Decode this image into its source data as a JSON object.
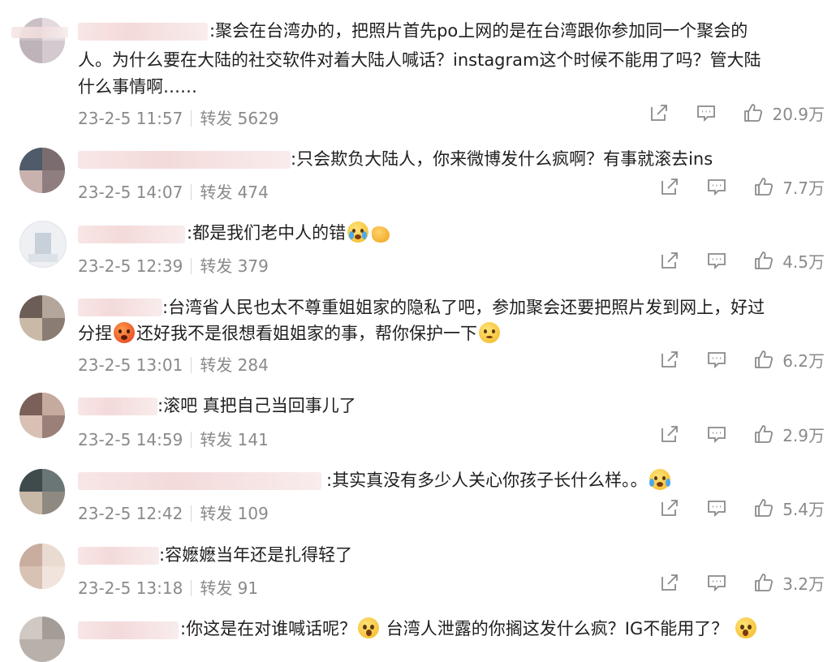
{
  "icons": {
    "share": "share-icon",
    "comment": "comment-icon",
    "like": "thumbs-up-icon"
  },
  "colors": {
    "meta": "#8a8a8a",
    "text": "#1f1f1f",
    "name_mask": "#f3d6d6"
  },
  "comments": [
    {
      "text_l1": ":聚会在台湾办的，把照片首先po上网的是在台湾跟你参加同一个聚会的",
      "text_l2": "人。为什么要在大陆的社交软件对着大陆人喊话？instagram这个时候不能用了吗？管大陆",
      "text_l3": "什么事情啊……",
      "date": "23-2-5 11:57",
      "repost": "转发 5629",
      "likes": "20.9万"
    },
    {
      "text_l1": ":只会欺负大陆人，你来微博发什么疯啊？有事就滚去ins",
      "date": "23-2-5 14:07",
      "repost": "转发 474",
      "likes": "7.7万"
    },
    {
      "text_l1": ":都是我们老中人的错",
      "date": "23-2-5 12:39",
      "repost": "转发 379",
      "likes": "4.5万"
    },
    {
      "text_l1": ":台湾省人民也太不尊重姐姐家的隐私了吧，参加聚会还要把照片发到网上，好过",
      "text_l2a": "分捏",
      "text_l2b": "还好我不是很想看姐姐家的事，帮你保护一下",
      "date": "23-2-5 13:01",
      "repost": "转发 284",
      "likes": "6.2万"
    },
    {
      "text_l1": ":滚吧 真把自己当回事儿了",
      "date": "23-2-5 14:59",
      "repost": "转发 141",
      "likes": "2.9万"
    },
    {
      "text_l1": ":其实真没有多少人关心你孩子长什么样。。",
      "date": "23-2-5 12:42",
      "repost": "转发 109",
      "likes": "5.4万"
    },
    {
      "text_l1": ":容嬷嬷当年还是扎得轻了",
      "date": "23-2-5 13:18",
      "repost": "转发 91",
      "likes": "3.2万"
    },
    {
      "text_l1a": ":你这是在对谁喊话呢？",
      "text_l1b": "台湾人泄露的你搁这发什么疯？IG不能用了？"
    }
  ]
}
